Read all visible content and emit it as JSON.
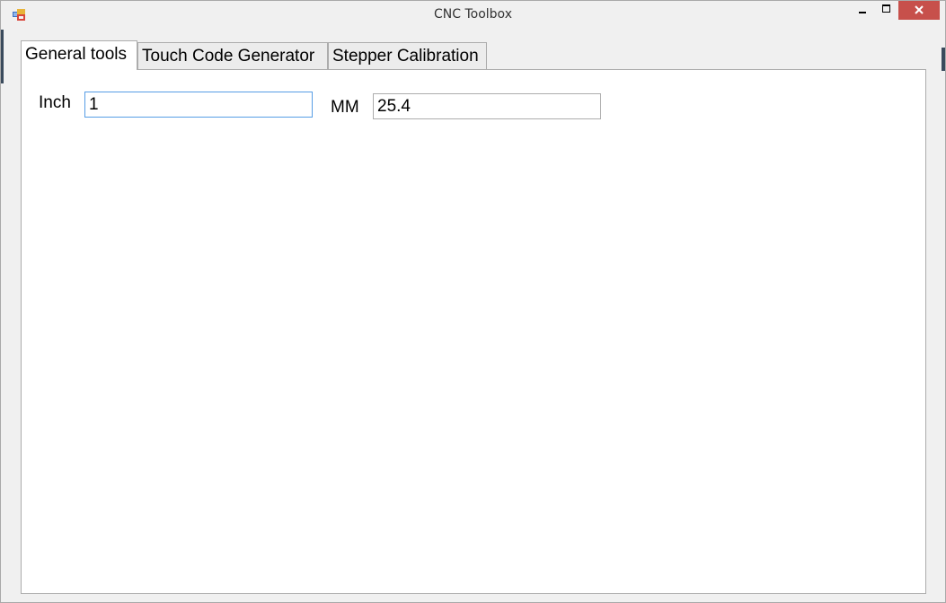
{
  "window": {
    "title": "CNC Toolbox"
  },
  "tabs": [
    {
      "label": "General tools",
      "active": true
    },
    {
      "label": "Touch Code Generator",
      "active": false
    },
    {
      "label": "Stepper Calibration",
      "active": false
    }
  ],
  "general_tools": {
    "inch_label": "Inch",
    "inch_value": "1",
    "mm_label": "MM",
    "mm_value": "25.4"
  },
  "colors": {
    "close_button": "#c7504b",
    "focus_border": "#569de5",
    "window_bg": "#f0f0f0"
  }
}
